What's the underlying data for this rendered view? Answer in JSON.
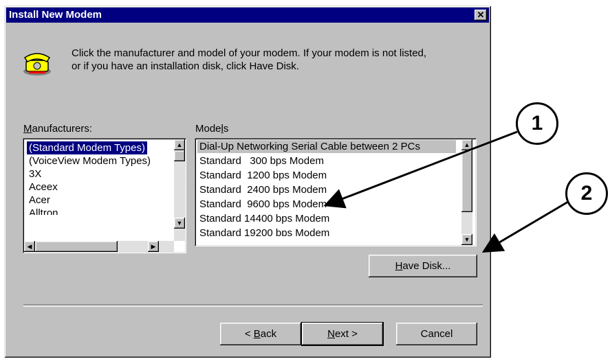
{
  "window": {
    "title": "Install New Modem",
    "close_glyph": "✕"
  },
  "intro": {
    "icon": "telephone-modem-icon",
    "line1": "Click the manufacturer and model of your modem. If your modem is not listed,",
    "line2": "or if you have an installation disk, click Have Disk."
  },
  "manufacturers": {
    "label_hot": "M",
    "label_rest": "anufacturers:",
    "items": [
      "(Standard Modem Types)",
      "(VoiceView Modem Types)",
      "3X",
      "Aceex",
      "Acer",
      "Alltron"
    ],
    "selected": "(Standard Modem Types)"
  },
  "models": {
    "label_pre": "Mode",
    "label_hot": "l",
    "label_post": "s",
    "items": [
      "Dial-Up Networking Serial Cable between 2 PCs",
      "Standard   300 bps Modem",
      "Standard  1200 bps Modem",
      "Standard  2400 bps Modem",
      "Standard  9600 bps Modem",
      "Standard 14400 bps Modem",
      "Standard 19200 bps Modem"
    ],
    "highlighted": "Dial-Up Networking Serial Cable between 2 PCs"
  },
  "buttons": {
    "have_disk_hot": "H",
    "have_disk_rest": "ave Disk...",
    "back_pre": "< ",
    "back_hot": "B",
    "back_rest": "ack",
    "next_hot": "N",
    "next_rest": "ext >",
    "cancel": "Cancel"
  },
  "callouts": [
    "1",
    "2"
  ],
  "colors": {
    "titlebar": "#000080",
    "face": "#c0c0c0",
    "selection": "#000080"
  }
}
